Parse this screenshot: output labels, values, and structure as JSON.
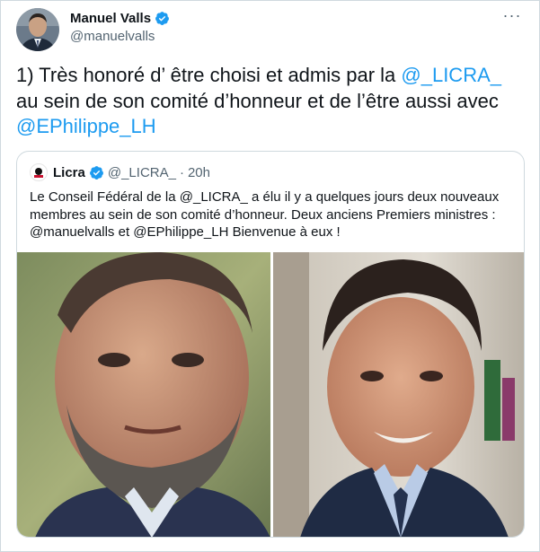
{
  "tweet": {
    "author_name": "Manuel Valls",
    "author_handle": "@manuelvalls",
    "more_icon": "···",
    "text_before": "1) Très honoré d’ être choisi et admis par la ",
    "mention_1": "@_LICRA_",
    "text_middle": " au sein de son comité d’honneur et de l’être aussi avec ",
    "mention_2": "@EPhilippe_LH"
  },
  "quote": {
    "name": "Licra",
    "handle": "@_LICRA_",
    "separator": "·",
    "time": "20h",
    "text": "Le Conseil Fédéral de la @_LICRA_ a élu il y a quelques jours deux nouveaux membres au sein de son comité d’honneur. Deux anciens Premiers ministres : @manuelvalls et @EPhilippe_LH Bienvenue à eux !"
  },
  "colors": {
    "link": "#1d9bf0",
    "verified": "#1d9bf0",
    "secondary_text": "#536471",
    "border": "#cfd9de"
  }
}
